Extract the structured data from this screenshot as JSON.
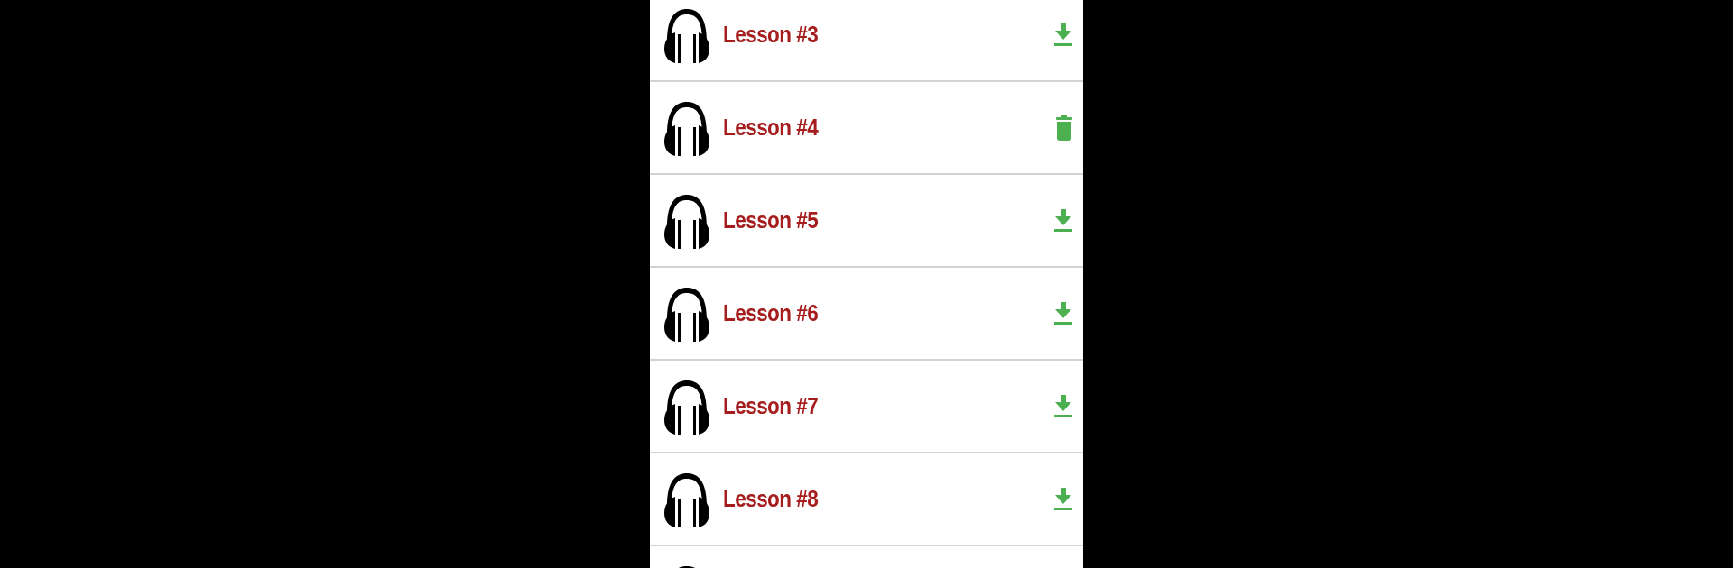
{
  "lessons": [
    {
      "label": "Lesson #3",
      "kind": "download"
    },
    {
      "label": "Lesson #4",
      "kind": "delete"
    },
    {
      "label": "Lesson #5",
      "kind": "download"
    },
    {
      "label": "Lesson #6",
      "kind": "download"
    },
    {
      "label": "Lesson #7",
      "kind": "download"
    },
    {
      "label": "Lesson #8",
      "kind": "download"
    },
    {
      "kind": "plain"
    }
  ]
}
